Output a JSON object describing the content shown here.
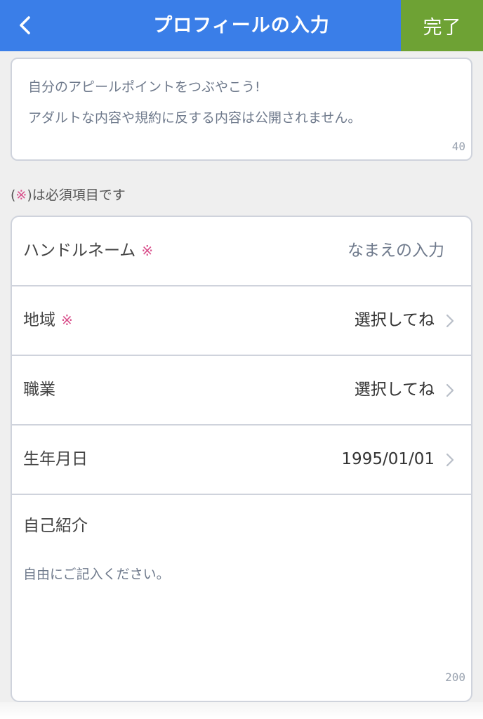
{
  "header": {
    "title": "プロフィールの入力",
    "done_label": "完了"
  },
  "appeal": {
    "placeholder_line1": "自分のアピールポイントをつぶやこう!",
    "placeholder_line2": "アダルトな内容や規約に反する内容は公開されません。",
    "max_chars": "40"
  },
  "required_note": {
    "open_paren": "(",
    "mark": "※",
    "text": ")は必須項目です"
  },
  "form": {
    "rows": [
      {
        "label": "ハンドルネーム",
        "required_mark": "※",
        "value": "なまえの入力"
      },
      {
        "label": "地域",
        "required_mark": "※",
        "value": "選択してね"
      },
      {
        "label": "職業",
        "value": "選択してね"
      },
      {
        "label": "生年月日",
        "value": "1995/01/01"
      }
    ],
    "intro": {
      "label": "自己紹介",
      "placeholder": "自由にご記入ください。",
      "max_chars": "200"
    }
  },
  "colors": {
    "header_bg": "#3a7ee8",
    "done_bg": "#6ea234",
    "required_mark": "#d94f8b"
  },
  "icons": {
    "back": "chevron-left-icon",
    "row_arrow": "chevron-right-icon"
  }
}
